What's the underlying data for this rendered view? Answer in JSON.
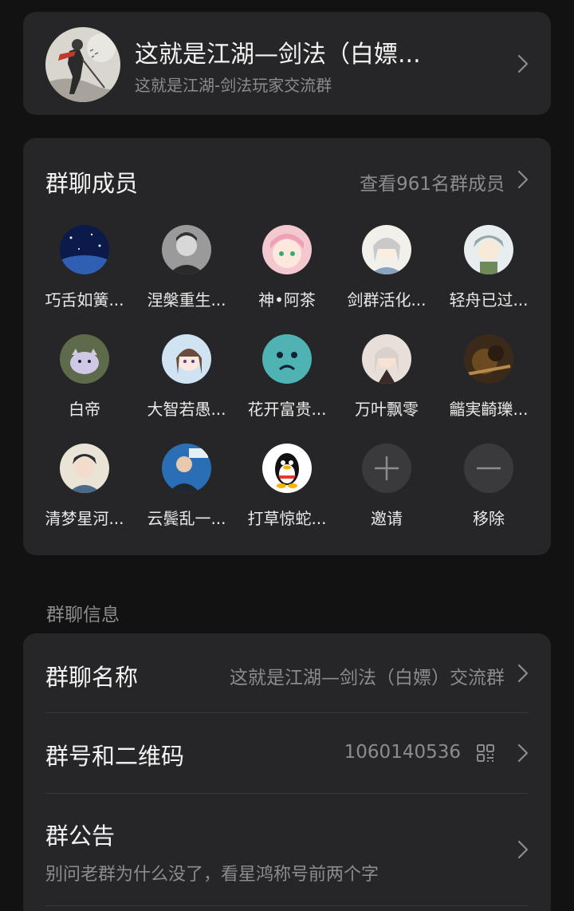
{
  "group": {
    "title": "这就是江湖—剑法（白嫖...",
    "subtitle": "这就是江湖-剑法玩家交流群"
  },
  "members": {
    "title": "群聊成员",
    "view_all": "查看961名群成员",
    "items": [
      {
        "name": "巧舌如簧...",
        "avatar": "starry-sky-avatar"
      },
      {
        "name": "涅槃重生...",
        "avatar": "portrait-avatar"
      },
      {
        "name": "神•阿茶",
        "avatar": "anime-girl-avatar"
      },
      {
        "name": "剑群活化...",
        "avatar": "anime-swordsman-avatar"
      },
      {
        "name": "轻舟已过...",
        "avatar": "anime-character-avatar"
      },
      {
        "name": "白帝",
        "avatar": "white-cat-avatar"
      },
      {
        "name": "大智若愚...",
        "avatar": "anime-girl-avatar"
      },
      {
        "name": "花开富贵...",
        "avatar": "teal-blob-avatar"
      },
      {
        "name": "万叶飘零",
        "avatar": "anime-character-avatar"
      },
      {
        "name": "龤実齮瓅...",
        "avatar": "dark-photo-avatar"
      },
      {
        "name": "清梦星河...",
        "avatar": "ancient-warrior-avatar"
      },
      {
        "name": "云鬓乱一...",
        "avatar": "person-suit-avatar"
      },
      {
        "name": "打草惊蛇...",
        "avatar": "qq-penguin-avatar"
      }
    ],
    "invite_label": "邀请",
    "remove_label": "移除"
  },
  "info": {
    "section_label": "群聊信息",
    "name_row": {
      "title": "群聊名称",
      "value": "这就是江湖—剑法（白嫖）交流群"
    },
    "id_row": {
      "title": "群号和二维码",
      "value": "1060140536"
    },
    "notice_row": {
      "title": "群公告",
      "value": "别问老群为什么没了，看星鸿称号前两个字"
    }
  },
  "colors": {
    "background": "#121212",
    "card": "#262628",
    "secondary_text": "#8c8c8e"
  }
}
